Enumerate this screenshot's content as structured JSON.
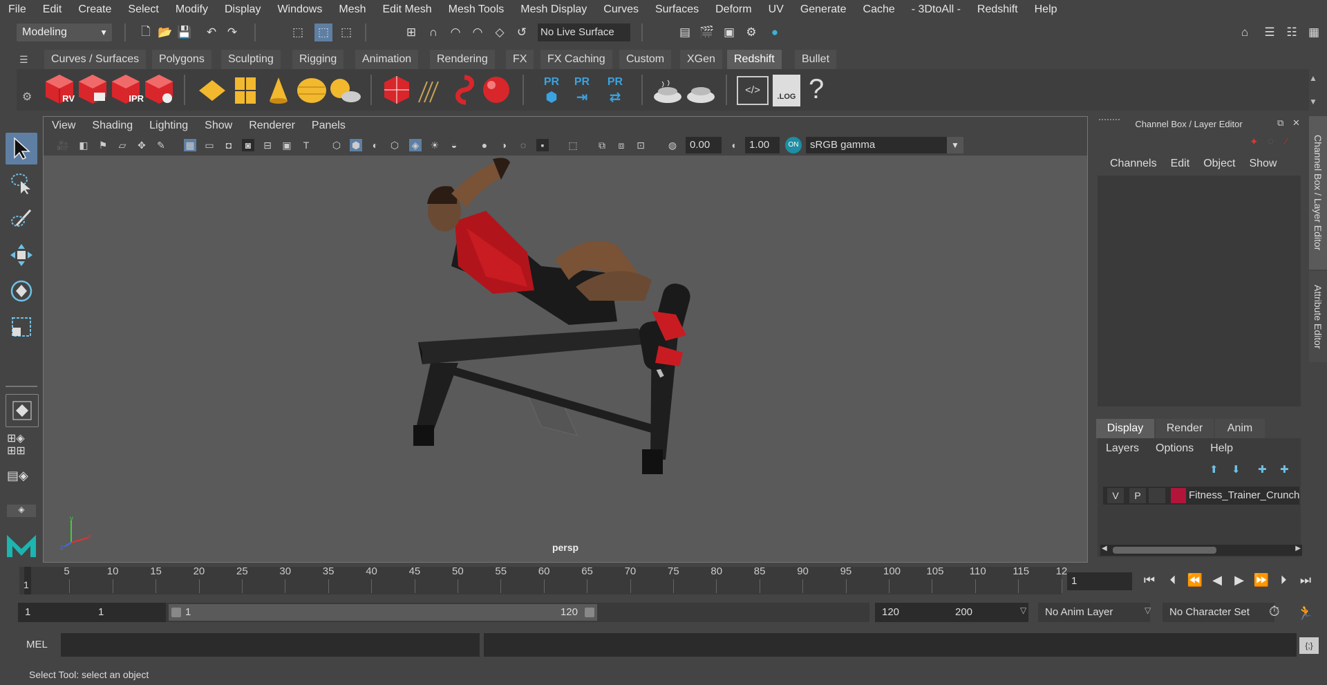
{
  "menubar": {
    "items": [
      "File",
      "Edit",
      "Create",
      "Select",
      "Modify",
      "Display",
      "Windows",
      "Mesh",
      "Edit Mesh",
      "Mesh Tools",
      "Mesh Display",
      "Curves",
      "Surfaces",
      "Deform",
      "UV",
      "Generate",
      "Cache",
      "- 3DtoAll -",
      "Redshift",
      "Help"
    ]
  },
  "statusline": {
    "mode": "Modeling",
    "live_surface": "No Live Surface"
  },
  "shelf": {
    "tabs": [
      "Curves / Surfaces",
      "Polygons",
      "Sculpting",
      "Rigging",
      "Animation",
      "Rendering",
      "FX",
      "FX Caching",
      "Custom",
      "XGen",
      "Redshift",
      "Bullet"
    ],
    "active_tab": "Redshift",
    "icon_labels": {
      "rv": "RV",
      "ipr": "IPR",
      "pr": "PR",
      "log": ".LOG",
      "help": "?"
    }
  },
  "viewport": {
    "menus": [
      "View",
      "Shading",
      "Lighting",
      "Show",
      "Renderer",
      "Panels"
    ],
    "exposure": "0.00",
    "gamma": "1.00",
    "color_space": "sRGB gamma",
    "camera_label": "persp"
  },
  "channelbox": {
    "title": "Channel Box / Layer Editor",
    "menus": [
      "Channels",
      "Edit",
      "Object",
      "Show"
    ],
    "layer_tabs": [
      "Display",
      "Render",
      "Anim"
    ],
    "active_layer_tab": "Display",
    "layer_menus": [
      "Layers",
      "Options",
      "Help"
    ],
    "layer": {
      "v": "V",
      "p": "P",
      "name": "Fitness_Trainer_Crunch",
      "color": "#b3153a"
    },
    "side_tabs": [
      "Channel Box / Layer Editor",
      "Attribute Editor"
    ]
  },
  "timeslider": {
    "ticks": [
      "5",
      "10",
      "15",
      "20",
      "25",
      "30",
      "35",
      "40",
      "45",
      "50",
      "55",
      "60",
      "65",
      "70",
      "75",
      "80",
      "85",
      "90",
      "95",
      "100",
      "105",
      "110",
      "115",
      "12"
    ],
    "start_marker": "1",
    "current_frame": "1"
  },
  "range": {
    "start": "1",
    "inner_start": "1",
    "slider_start": "1",
    "slider_end": "120",
    "inner_end": "120",
    "end": "200",
    "anim_layer": "No Anim Layer",
    "character_set": "No Character Set"
  },
  "command": {
    "label": "MEL"
  },
  "help_line": "Select Tool: select an object",
  "colors": {
    "accent": "#5e7fa3",
    "layer": "#b3153a",
    "redshift_red": "#d8262b",
    "yellow": "#f2b82e",
    "pr_blue": "#3aa3e0"
  }
}
